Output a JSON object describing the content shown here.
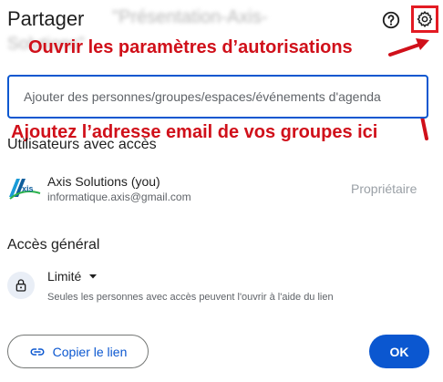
{
  "dialog": {
    "title": "Partager",
    "document_name_line1": "\"Présentation-Axis-",
    "document_name_line2": "Solutions\""
  },
  "annotations": {
    "settings_note": "Ouvrir les paramètres d’autorisations",
    "email_note": "Ajoutez l’adresse email de vos groupes ici"
  },
  "people_input": {
    "placeholder": "Ajouter des personnes/groupes/espaces/événements d'agenda"
  },
  "users_section": {
    "heading": "Utilisateurs avec accès",
    "users": [
      {
        "name": "Axis Solutions (you)",
        "email": "informatique.axis@gmail.com",
        "role": "Propriétaire",
        "avatar_text": "xis"
      }
    ]
  },
  "general_access": {
    "heading": "Accès général",
    "level": "Limité",
    "description": "Seules les personnes avec accès peuvent l'ouvrir à l'aide du lien"
  },
  "footer": {
    "copy_link_label": "Copier le lien",
    "ok_label": "OK"
  },
  "colors": {
    "annotation_red": "#d0101a",
    "primary_blue": "#0b57d0",
    "input_border": "#0b57d0"
  },
  "icons": {
    "help": "help-circle-icon",
    "settings": "gear-icon",
    "lock": "lock-icon",
    "dropdown": "caret-down-icon",
    "link": "link-icon"
  }
}
